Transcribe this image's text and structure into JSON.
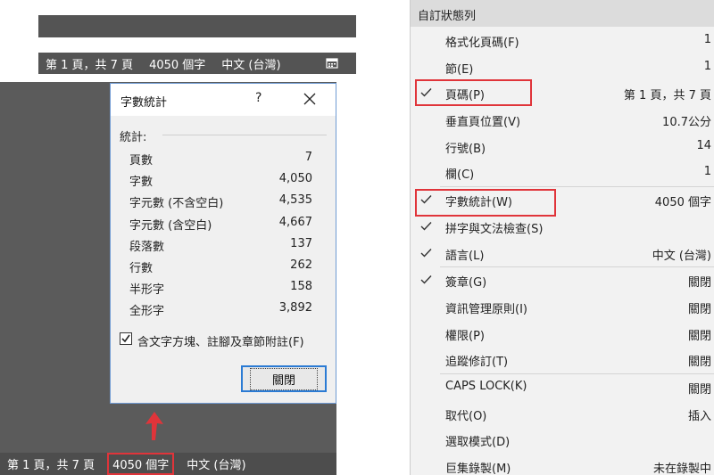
{
  "top_status": {
    "page": "第 1 頁，共 7 頁",
    "words": "4050 個字",
    "language": "中文 (台灣)",
    "icon": "calendar-icon"
  },
  "bottom_status": {
    "page": "第 1 頁，共 7 頁",
    "words": "4050 個字",
    "language": "中文 (台灣)"
  },
  "dialog": {
    "title": "字數統計",
    "help": "?",
    "section_label": "統計:",
    "stats": [
      {
        "label": "頁數",
        "value": "7"
      },
      {
        "label": "字數",
        "value": "4,050"
      },
      {
        "label": "字元數 (不含空白)",
        "value": "4,535"
      },
      {
        "label": "字元數 (含空白)",
        "value": "4,667"
      },
      {
        "label": "段落數",
        "value": "137"
      },
      {
        "label": "行數",
        "value": "262"
      },
      {
        "label": "半形字",
        "value": "158"
      },
      {
        "label": "全形字",
        "value": "3,892"
      }
    ],
    "include_label": "含文字方塊、註腳及章節附註(F)",
    "include_checked": true,
    "close_button": "關閉"
  },
  "menu": {
    "header": "自訂狀態列",
    "items": [
      {
        "label": "格式化頁碼(F)",
        "value": "1",
        "checked": false
      },
      {
        "label": "節(E)",
        "value": "1",
        "checked": false
      },
      {
        "label": "頁碼(P)",
        "value": "第 1 頁，共 7 頁",
        "checked": true
      },
      {
        "label": "垂直頁位置(V)",
        "value": "10.7公分",
        "checked": false
      },
      {
        "label": "行號(B)",
        "value": "14",
        "checked": false
      },
      {
        "label": "欄(C)",
        "value": "1",
        "checked": false
      },
      {
        "label": "字數統計(W)",
        "value": "4050 個字",
        "checked": true
      },
      {
        "label": "拼字與文法檢查(S)",
        "value": "",
        "checked": true
      },
      {
        "label": "語言(L)",
        "value": "中文 (台灣)",
        "checked": true
      },
      {
        "label": "簽章(G)",
        "value": "關閉",
        "checked": true
      },
      {
        "label": "資訊管理原則(I)",
        "value": "關閉",
        "checked": false
      },
      {
        "label": "權限(P)",
        "value": "關閉",
        "checked": false
      },
      {
        "label": "追蹤修訂(T)",
        "value": "關閉",
        "checked": false
      },
      {
        "label": "CAPS LOCK(K)",
        "value": "關閉",
        "checked": false
      },
      {
        "label": "取代(O)",
        "value": "插入",
        "checked": false
      },
      {
        "label": "選取模式(D)",
        "value": "",
        "checked": false
      },
      {
        "label": "巨集錄製(M)",
        "value": "未在錄製中",
        "checked": false
      }
    ]
  },
  "colors": {
    "highlight_red": "#e0343a",
    "status_gray": "#545454",
    "accent_blue": "#2b7bd4"
  }
}
